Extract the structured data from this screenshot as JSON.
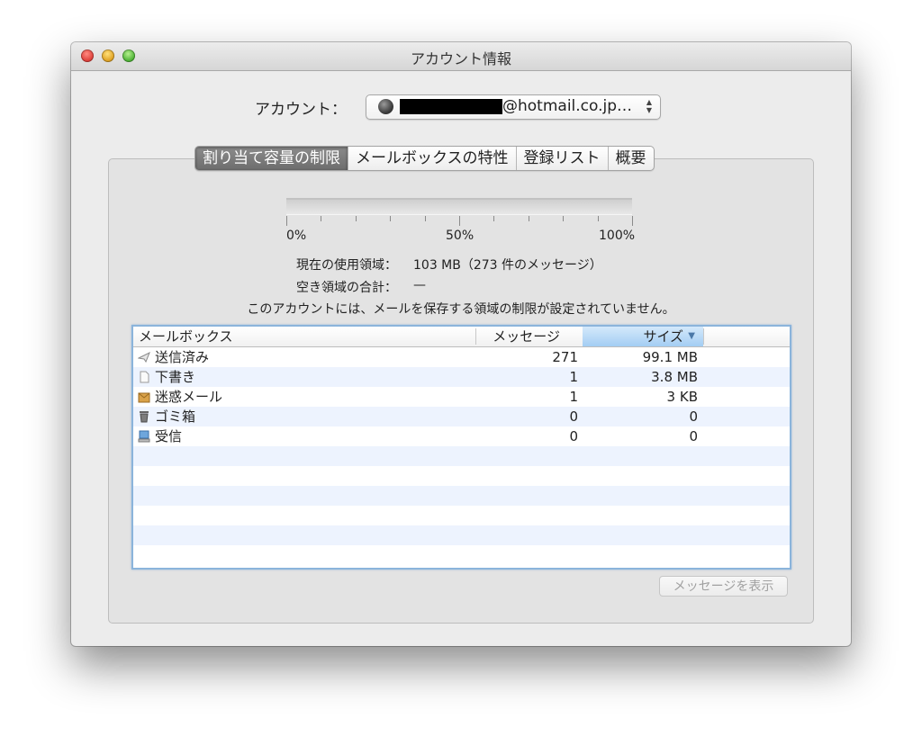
{
  "window": {
    "title": "アカウント情報"
  },
  "account": {
    "label": "アカウント：",
    "value": "@hotmail.co.jp…"
  },
  "tabs": [
    {
      "label": "割り当て容量の制限",
      "selected": true
    },
    {
      "label": "メールボックスの特性",
      "selected": false
    },
    {
      "label": "登録リスト",
      "selected": false
    },
    {
      "label": "概要",
      "selected": false
    }
  ],
  "quota": {
    "usage_fraction": 0,
    "ticks": {
      "start": "0%",
      "mid": "50%",
      "end": "100%"
    },
    "current_usage_label": "現在の使用領域：",
    "current_usage_value": "103 MB（273 件のメッセージ）",
    "free_space_label": "空き領域の合計：",
    "free_space_value": "—",
    "notice": "このアカウントには、メールを保存する領域の制限が設定されていません。"
  },
  "table": {
    "columns": {
      "mailbox": "メールボックス",
      "messages": "メッセージ",
      "size": "サイズ"
    },
    "sort": {
      "column": "size",
      "direction": "descending"
    },
    "rows": [
      {
        "icon": "sent-icon",
        "name": "送信済み",
        "messages": "271",
        "size": "99.1 MB"
      },
      {
        "icon": "drafts-icon",
        "name": "下書き",
        "messages": "1",
        "size": "3.8 MB"
      },
      {
        "icon": "junk-icon",
        "name": "迷惑メール",
        "messages": "1",
        "size": "3 KB"
      },
      {
        "icon": "trash-icon",
        "name": "ゴミ箱",
        "messages": "0",
        "size": "0"
      },
      {
        "icon": "inbox-icon",
        "name": "受信",
        "messages": "0",
        "size": "0"
      }
    ]
  },
  "buttons": {
    "show_messages": "メッセージを表示",
    "show_messages_enabled": false
  },
  "colors": {
    "selected_tab": "#7a7a7a",
    "sort_header": "#a3cdf3",
    "row_alternate": "#edf3fe",
    "table_focus_ring": "#8bb4db"
  }
}
